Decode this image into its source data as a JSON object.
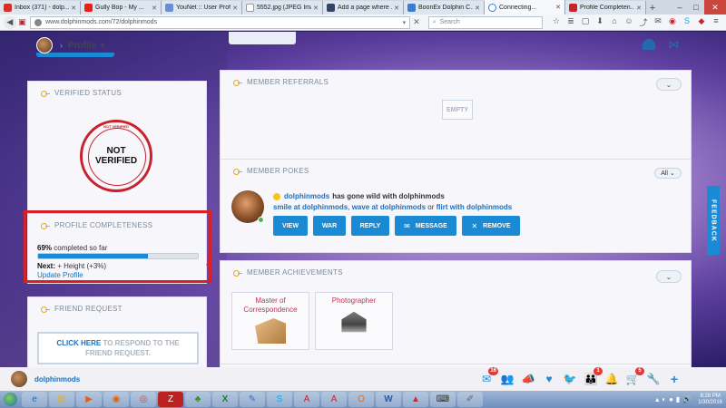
{
  "browser": {
    "tabs": [
      {
        "label": "Inbox (371) - dolp...",
        "color": "#d93025"
      },
      {
        "label": "Gully Bop - My ...",
        "color": "#e62117"
      },
      {
        "label": "YouNet :: User Profi...",
        "color": "#6a8fd0"
      },
      {
        "label": "5552.jpg (JPEG Imag...",
        "color": "#ffffff"
      },
      {
        "label": "Add a page where ...",
        "color": "#334466"
      },
      {
        "label": "BoonEx Dolphin C...",
        "color": "#3a7bd5"
      },
      {
        "label": "Connecting...",
        "color": "#3a7bd5",
        "active": true
      },
      {
        "label": "Profile Completen...",
        "color": "#c8232c"
      }
    ],
    "url": "www.dolphinmods.com/72/dolphinmods",
    "search_placeholder": "Search"
  },
  "header": {
    "profile_label": "Profile"
  },
  "verified": {
    "title": "VERIFIED STATUS",
    "seal_text": "NOT VERIFIED",
    "ring_text": "NOT VERIFIED"
  },
  "completeness": {
    "title": "PROFILE COMPLETENESS",
    "percent": "69%",
    "percent_value": 69,
    "suffix": "completed so far",
    "next_label": "Next:",
    "next_value": "+ Height (+3%)",
    "update_link": "Update Profile"
  },
  "friend_request": {
    "title": "FRIEND REQUEST",
    "click_here": "CLICK HERE",
    "message": "TO RESPOND TO THE FRIEND REQUEST."
  },
  "referrals": {
    "title": "MEMBER REFERRALS",
    "empty": "EMPTY"
  },
  "pokes": {
    "title": "MEMBER POKES",
    "filter": "All",
    "user": "dolphinmods",
    "text": "has gone wild with dolphinmods",
    "link1": "smile at dolphinmods",
    "link2": "wave at dolphinmods",
    "or": "or",
    "link3": "flirt with dolphinmods",
    "buttons": {
      "view": "VIEW",
      "war": "WAR",
      "reply": "REPLY",
      "message": "MESSAGE",
      "remove": "REMOVE"
    }
  },
  "achievements": {
    "title": "MEMBER ACHIEVEMENTS",
    "items": [
      {
        "name": "Master of Correspondence"
      },
      {
        "name": "Photographer"
      }
    ]
  },
  "feedback": "FEEDBACK",
  "sitebar": {
    "username": "dolphinmods",
    "badges": {
      "mail": "16",
      "friends": "1",
      "cart": "5"
    }
  },
  "taskbar": {
    "time": "8:28 PM",
    "date": "1/30/2016"
  }
}
